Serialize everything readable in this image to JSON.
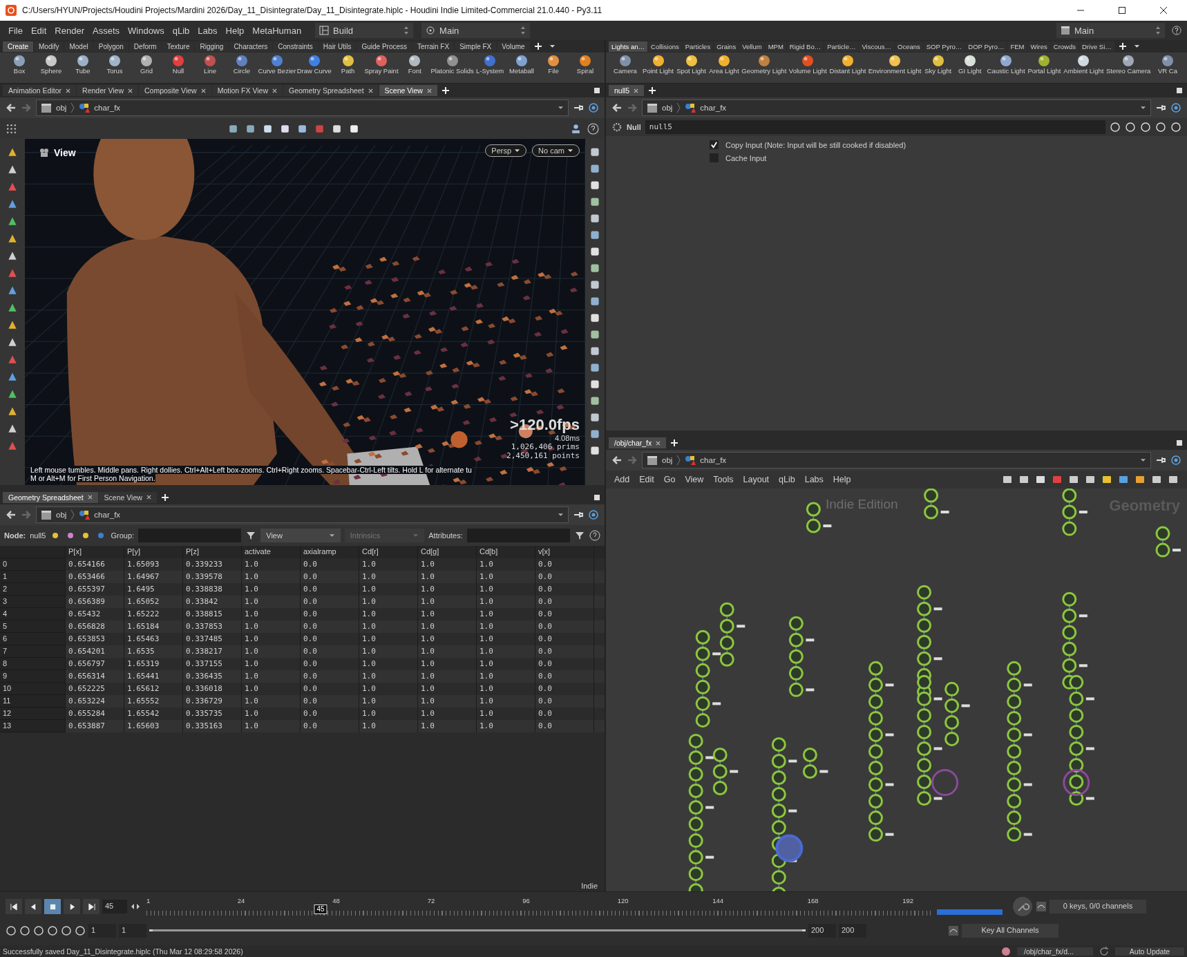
{
  "window": {
    "title": "C:/Users/HYUN/Projects/Houdini Projects/Mardini 2026/Day_11_Disintegrate/Day_11_Disintegrate.hiplc - Houdini Indie Limited-Commercial 21.0.440 - Py3.11"
  },
  "menu": [
    "File",
    "Edit",
    "Render",
    "Assets",
    "Windows",
    "qLib",
    "Labs",
    "Help",
    "MetaHuman"
  ],
  "desktop": "Build",
  "context_left": "Main",
  "context_right": "Main",
  "shelf_left": {
    "tabs": [
      {
        "label": "Create",
        "selected": true
      },
      {
        "label": "Modify",
        "selected": false
      },
      {
        "label": "Model",
        "selected": false
      },
      {
        "label": "Polygon",
        "selected": false
      },
      {
        "label": "Deform",
        "selected": false
      },
      {
        "label": "Texture",
        "selected": false
      },
      {
        "label": "Rigging",
        "selected": false
      },
      {
        "label": "Characters",
        "selected": false
      },
      {
        "label": "Constraints",
        "selected": false
      },
      {
        "label": "Hair Utils",
        "selected": false
      },
      {
        "label": "Guide Process",
        "selected": false
      },
      {
        "label": "Terrain FX",
        "selected": false
      },
      {
        "label": "Simple FX",
        "selected": false
      },
      {
        "label": "Volume",
        "selected": false
      }
    ],
    "tools": [
      {
        "label": "Box",
        "color": "#8aa0b8"
      },
      {
        "label": "Sphere",
        "color": "#c8c8c8"
      },
      {
        "label": "Tube",
        "color": "#9ab0c8"
      },
      {
        "label": "Torus",
        "color": "#a0b4c8"
      },
      {
        "label": "Grid",
        "color": "#b0b0b0"
      },
      {
        "label": "Null",
        "color": "#e04040"
      },
      {
        "label": "Line",
        "color": "#c05050"
      },
      {
        "label": "Circle",
        "color": "#6080c0"
      },
      {
        "label": "Curve Bezier",
        "color": "#5080d0"
      },
      {
        "label": "Draw Curve",
        "color": "#4080e0"
      },
      {
        "label": "Path",
        "color": "#e0c040"
      },
      {
        "label": "Spray Paint",
        "color": "#e06060"
      },
      {
        "label": "Font",
        "color": "#b0b8c0"
      },
      {
        "label": "Platonic Solids",
        "color": "#909090"
      },
      {
        "label": "L-System",
        "color": "#4070d0"
      },
      {
        "label": "Metaball",
        "color": "#80a0d0"
      },
      {
        "label": "File",
        "color": "#e09040"
      },
      {
        "label": "Spiral",
        "color": "#e08020"
      }
    ]
  },
  "shelf_right": {
    "tabs": [
      {
        "label": "Lights an…",
        "selected": true
      },
      {
        "label": "Collisions",
        "selected": false
      },
      {
        "label": "Particles",
        "selected": false
      },
      {
        "label": "Grains",
        "selected": false
      },
      {
        "label": "Vellum",
        "selected": false
      },
      {
        "label": "MPM",
        "selected": false
      },
      {
        "label": "Rigid Bo…",
        "selected": false
      },
      {
        "label": "Particle…",
        "selected": false
      },
      {
        "label": "Viscous…",
        "selected": false
      },
      {
        "label": "Oceans",
        "selected": false
      },
      {
        "label": "SOP Pyro…",
        "selected": false
      },
      {
        "label": "DOP Pyro…",
        "selected": false
      },
      {
        "label": "FEM",
        "selected": false
      },
      {
        "label": "Wires",
        "selected": false
      },
      {
        "label": "Crowds",
        "selected": false
      },
      {
        "label": "Drive Si…",
        "selected": false
      }
    ],
    "tools": [
      {
        "label": "Camera",
        "color": "#8090a8"
      },
      {
        "label": "Point Light",
        "color": "#f0b030"
      },
      {
        "label": "Spot Light",
        "color": "#f0c040"
      },
      {
        "label": "Area Light",
        "color": "#f0b030"
      },
      {
        "label": "Geometry Light",
        "color": "#c08040"
      },
      {
        "label": "Volume Light",
        "color": "#e05020"
      },
      {
        "label": "Distant Light",
        "color": "#f0b030"
      },
      {
        "label": "Environment Light",
        "color": "#f0c050"
      },
      {
        "label": "Sky Light",
        "color": "#e0c040"
      },
      {
        "label": "GI Light",
        "color": "#d8e0d8"
      },
      {
        "label": "Caustic Light",
        "color": "#90a8d0"
      },
      {
        "label": "Portal Light",
        "color": "#a0b030"
      },
      {
        "label": "Ambient Light",
        "color": "#d0d8e0"
      },
      {
        "label": "Stereo Camera",
        "color": "#a0a8b8"
      },
      {
        "label": "VR Ca",
        "color": "#8090a8"
      }
    ]
  },
  "left_tabs": [
    {
      "label": "Animation Editor",
      "selected": false
    },
    {
      "label": "Render View",
      "selected": false
    },
    {
      "label": "Composite View",
      "selected": false
    },
    {
      "label": "Motion FX View",
      "selected": false
    },
    {
      "label": "Geometry Spreadsheet",
      "selected": false
    },
    {
      "label": "Scene View",
      "selected": true
    }
  ],
  "viewport": {
    "path": [
      "obj",
      "char_fx"
    ],
    "label": "View",
    "projection": "Persp",
    "camera": "No cam",
    "fps": ">120.0fps",
    "time": "4.08ms",
    "prims": "1,026,406 prims",
    "points": "2,450,161 points",
    "help": [
      "Left mouse tumbles. Middle pans. Right dollies. Ctrl+Alt+Left box-zooms. Ctrl+Right zooms. Spacebar-Ctrl-Left tilts. Hold L for alternate tu",
      "M or Alt+M for First Person Navigation."
    ]
  },
  "spreadsheet": {
    "tabs": [
      {
        "label": "Geometry Spreadsheet",
        "selected": true
      },
      {
        "label": "Scene View",
        "selected": false
      }
    ],
    "path": [
      "obj",
      "char_fx"
    ],
    "node_label": "Node:",
    "node": "null5",
    "group_label": "Group:",
    "view": "View",
    "intrinsics": "Intrinsics",
    "attributes_label": "Attributes:",
    "columns": [
      "",
      "P[x]",
      "P[y]",
      "P[z]",
      "activate",
      "axialramp",
      "Cd[r]",
      "Cd[g]",
      "Cd[b]",
      "v[x]"
    ],
    "rows": [
      [
        "0",
        "0.654166",
        "1.65093",
        "0.339233",
        "1.0",
        "0.0",
        "1.0",
        "1.0",
        "1.0",
        "0.0"
      ],
      [
        "1",
        "0.653466",
        "1.64967",
        "0.339578",
        "1.0",
        "0.0",
        "1.0",
        "1.0",
        "1.0",
        "0.0"
      ],
      [
        "2",
        "0.655397",
        "1.6495",
        "0.338838",
        "1.0",
        "0.0",
        "1.0",
        "1.0",
        "1.0",
        "0.0"
      ],
      [
        "3",
        "0.656389",
        "1.65052",
        "0.33842",
        "1.0",
        "0.0",
        "1.0",
        "1.0",
        "1.0",
        "0.0"
      ],
      [
        "4",
        "0.65432",
        "1.65222",
        "0.338815",
        "1.0",
        "0.0",
        "1.0",
        "1.0",
        "1.0",
        "0.0"
      ],
      [
        "5",
        "0.656828",
        "1.65184",
        "0.337853",
        "1.0",
        "0.0",
        "1.0",
        "1.0",
        "1.0",
        "0.0"
      ],
      [
        "6",
        "0.653853",
        "1.65463",
        "0.337485",
        "1.0",
        "0.0",
        "1.0",
        "1.0",
        "1.0",
        "0.0"
      ],
      [
        "7",
        "0.654201",
        "1.6535",
        "0.338217",
        "1.0",
        "0.0",
        "1.0",
        "1.0",
        "1.0",
        "0.0"
      ],
      [
        "8",
        "0.656797",
        "1.65319",
        "0.337155",
        "1.0",
        "0.0",
        "1.0",
        "1.0",
        "1.0",
        "0.0"
      ],
      [
        "9",
        "0.656314",
        "1.65441",
        "0.336435",
        "1.0",
        "0.0",
        "1.0",
        "1.0",
        "1.0",
        "0.0"
      ],
      [
        "10",
        "0.652225",
        "1.65612",
        "0.336018",
        "1.0",
        "0.0",
        "1.0",
        "1.0",
        "1.0",
        "0.0"
      ],
      [
        "11",
        "0.653224",
        "1.65552",
        "0.336729",
        "1.0",
        "0.0",
        "1.0",
        "1.0",
        "1.0",
        "0.0"
      ],
      [
        "12",
        "0.655284",
        "1.65542",
        "0.335735",
        "1.0",
        "0.0",
        "1.0",
        "1.0",
        "1.0",
        "0.0"
      ],
      [
        "13",
        "0.653887",
        "1.65603",
        "0.335163",
        "1.0",
        "0.0",
        "1.0",
        "1.0",
        "1.0",
        "0.0"
      ]
    ],
    "badge": "Indie"
  },
  "params": {
    "tabs": [
      {
        "label": "null5",
        "selected": true
      }
    ],
    "path": [
      "obj",
      "char_fx"
    ],
    "type": "Null",
    "name": "null5",
    "toggles": [
      {
        "label": "Copy Input (Note: Input will be still cooked if disabled)",
        "checked": true
      },
      {
        "label": "Cache Input",
        "checked": false
      }
    ]
  },
  "network": {
    "tabs": [
      {
        "label": "/obj/char_fx",
        "selected": true
      }
    ],
    "path": [
      "obj",
      "char_fx"
    ],
    "menu": [
      "Add",
      "Edit",
      "Go",
      "View",
      "Tools",
      "Layout",
      "qLib",
      "Labs",
      "Help"
    ],
    "edition": "Indie Edition",
    "context": "Geometry"
  },
  "timeline": {
    "frame": "45",
    "marker": "45",
    "level": 0.221,
    "ticks": [
      "1",
      "24",
      "48",
      "72",
      "96",
      "120",
      "144",
      "168",
      "192"
    ],
    "range_start": "1",
    "playback_start": "1",
    "playback_end": "200",
    "range_end": "200",
    "keys": "0 keys, 0/0 channels",
    "key_mode": "Key All Channels"
  },
  "status": {
    "message": "Successfully saved Day_11_Disintegrate.hiplc (Thu Mar 12 08:29:58 2026)",
    "path": "/obj/char_fx/d...",
    "update": "Auto Update"
  }
}
